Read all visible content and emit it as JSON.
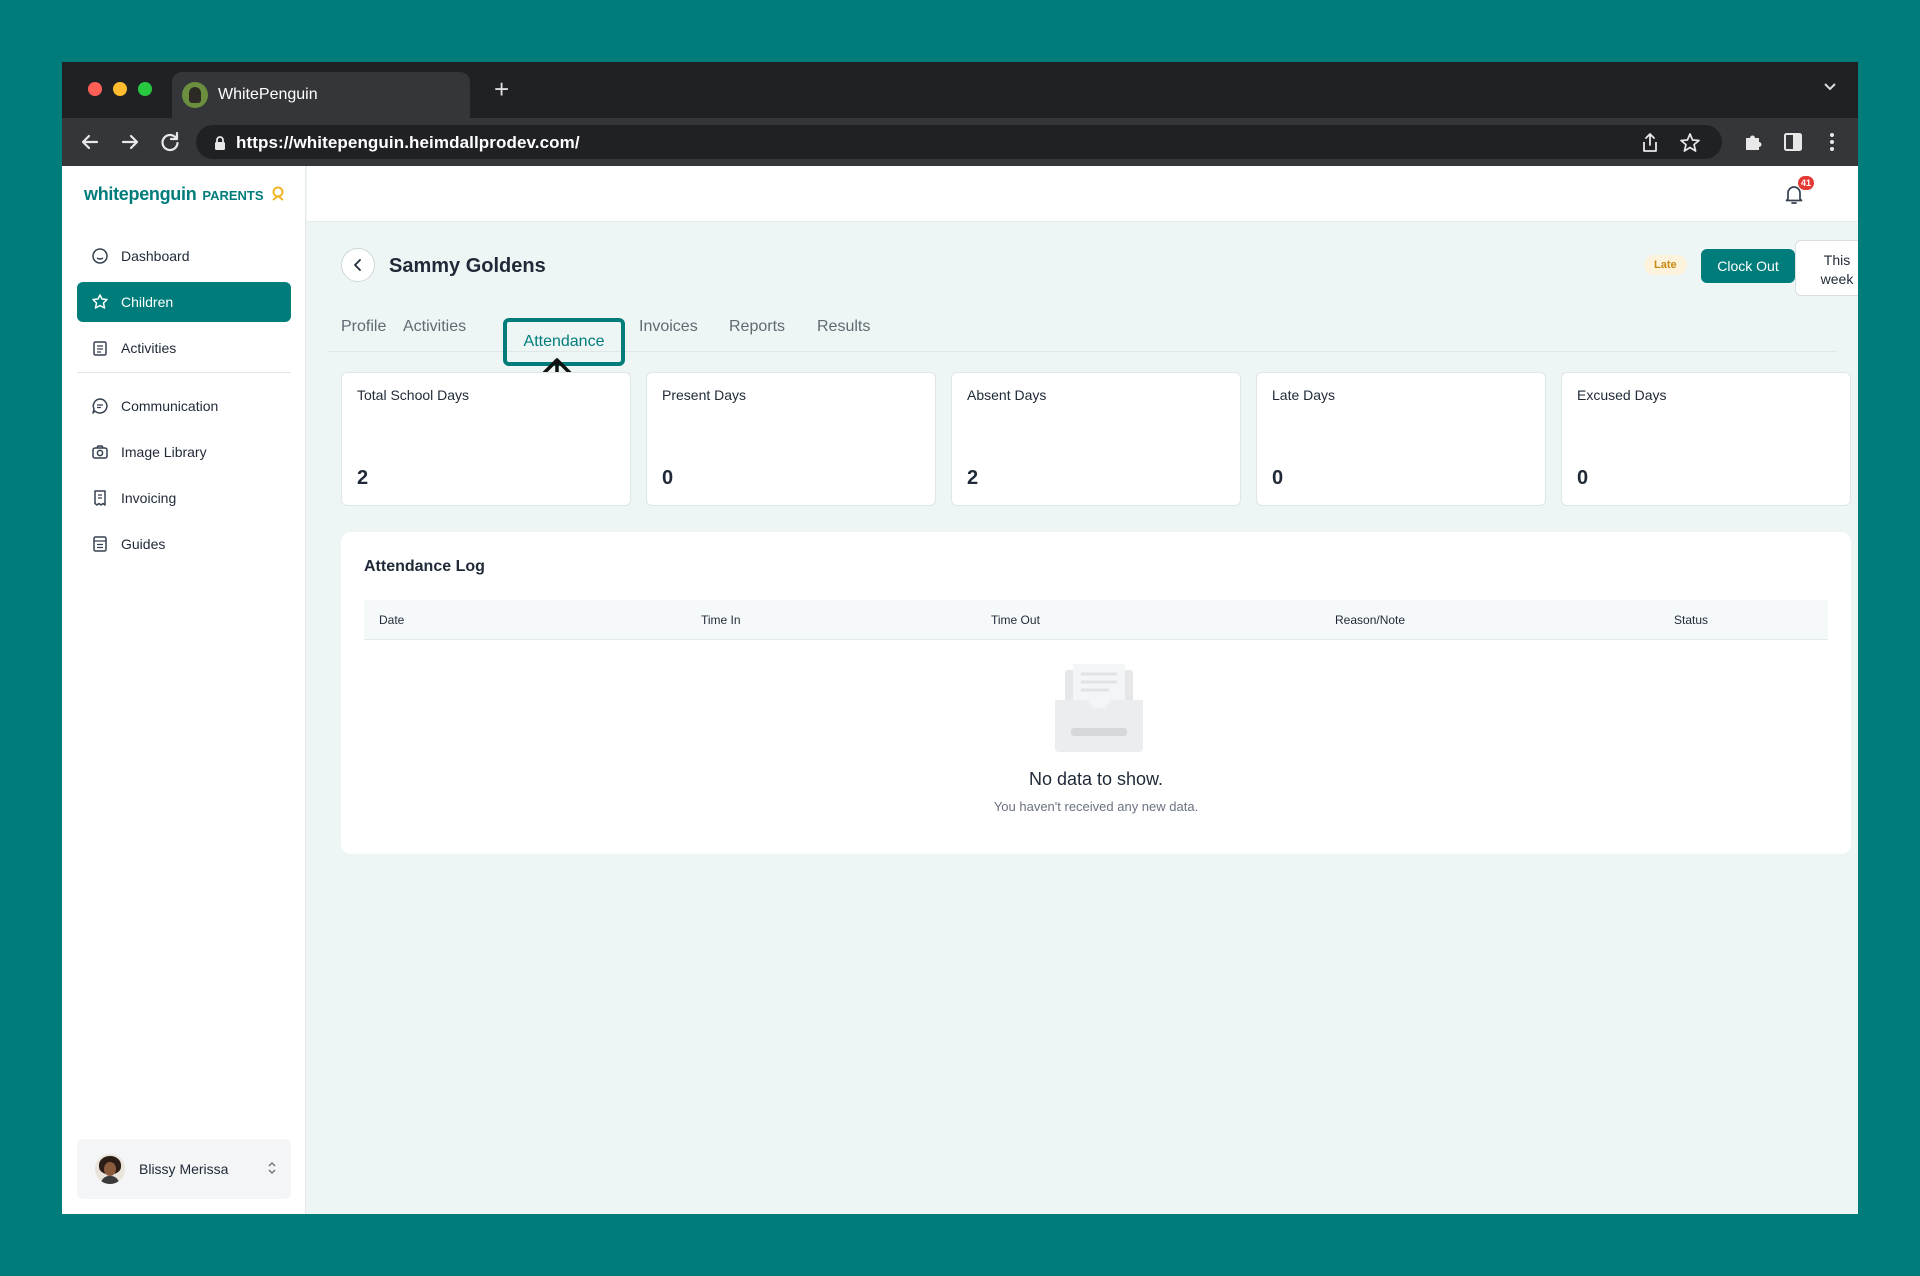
{
  "browser": {
    "tab_title": "WhitePenguin",
    "url": "https://whitepenguin.heimdallprodev.com/"
  },
  "brand": {
    "logo_word": "whitepenguin",
    "logo_tag": "PARENTS",
    "accent": "#007d7b"
  },
  "sidebar": {
    "items": [
      {
        "label": "Dashboard",
        "icon": "dashboard-icon",
        "active": false
      },
      {
        "label": "Children",
        "icon": "children-icon",
        "active": true
      },
      {
        "label": "Activities",
        "icon": "activities-icon",
        "active": false
      },
      {
        "label": "Communication",
        "icon": "chat-icon",
        "active": false
      },
      {
        "label": "Image Library",
        "icon": "camera-icon",
        "active": false
      },
      {
        "label": "Invoicing",
        "icon": "invoice-icon",
        "active": false
      },
      {
        "label": "Guides",
        "icon": "book-icon",
        "active": false
      }
    ],
    "user": {
      "name": "Blissy Merissa"
    }
  },
  "topbar": {
    "notification_count": "41"
  },
  "child": {
    "name": "Sammy Goldens",
    "status_badge": "Late",
    "clock_out_label": "Clock Out",
    "range_label": "This week"
  },
  "tabs": [
    "Profile",
    "Activities",
    "Attendance",
    "Invoices",
    "Reports",
    "Results"
  ],
  "active_tab": "Attendance",
  "stats": [
    {
      "label": "Total School Days",
      "value": "2"
    },
    {
      "label": "Present Days",
      "value": "0"
    },
    {
      "label": "Absent Days",
      "value": "2"
    },
    {
      "label": "Late Days",
      "value": "0"
    },
    {
      "label": "Excused Days",
      "value": "0"
    }
  ],
  "log": {
    "title": "Attendance Log",
    "columns": [
      "Date",
      "Time In",
      "Time Out",
      "Reason/Note",
      "Status"
    ],
    "empty_title": "No data to show.",
    "empty_subtitle": "You haven't received any new data."
  }
}
